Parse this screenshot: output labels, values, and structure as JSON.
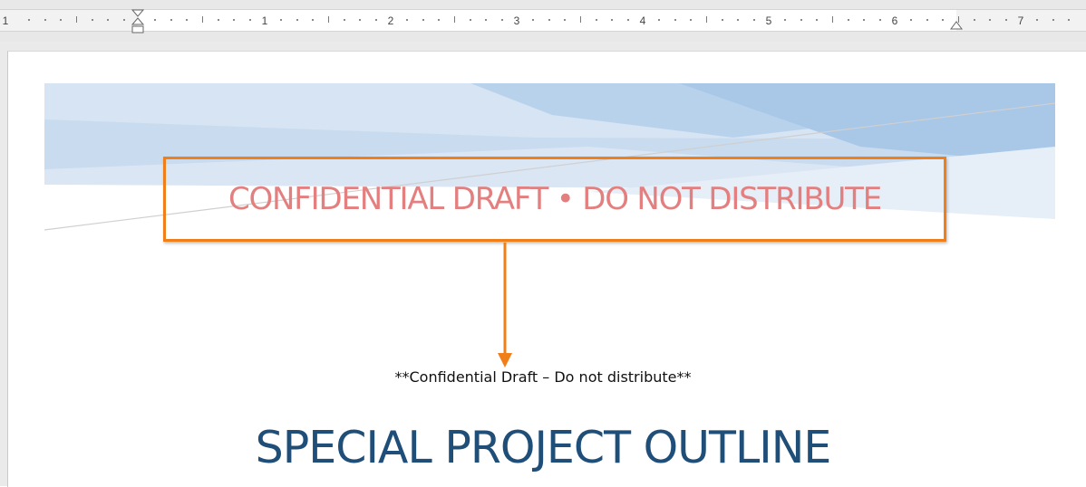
{
  "ruler": {
    "labels": [
      "1",
      "1",
      "2",
      "3",
      "4",
      "5",
      "6",
      "7"
    ]
  },
  "header": {
    "watermark_text": "CONFIDENTIAL DRAFT • DO NOT DISTRIBUTE"
  },
  "document": {
    "body_text": "**Confidential Draft – Do not distribute**",
    "title": "SPECIAL PROJECT OUTLINE"
  },
  "colors": {
    "callout_border": "#f07f1a",
    "watermark": "#e37f7f",
    "title": "#1f4e79",
    "header_band_light": "#dbe7f4",
    "header_band_dark": "#a9c8e8"
  }
}
